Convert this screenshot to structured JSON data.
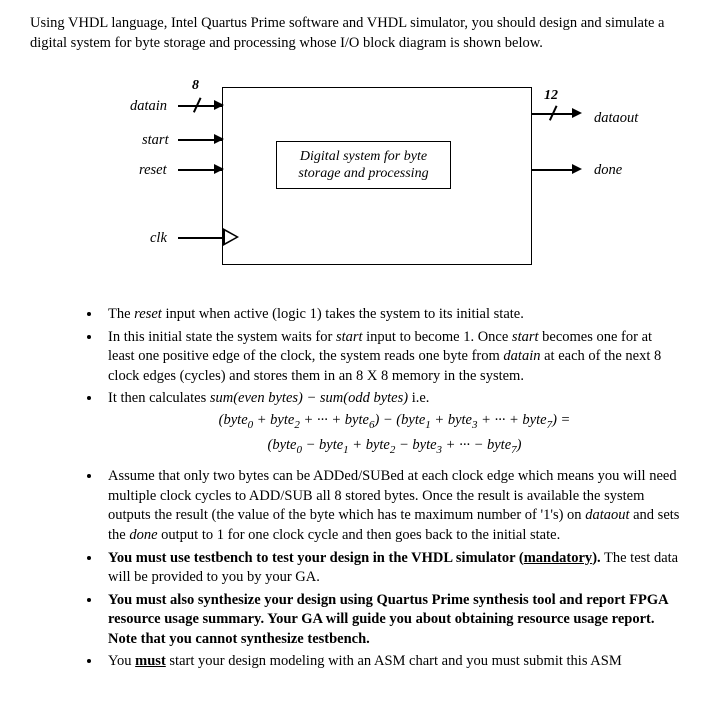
{
  "intro": "Using VHDL language, Intel Quartus Prime software and VHDL simulator, you should design and simulate a digital system for byte storage and processing whose I/O block diagram is shown below.",
  "diagram": {
    "datain": "datain",
    "start": "start",
    "reset": "reset",
    "clk": "clk",
    "dataout": "dataout",
    "done": "done",
    "bus_in": "8",
    "bus_out": "12",
    "box_line1": "Digital system for byte",
    "box_line2": "storage and processing"
  },
  "bullets": {
    "b1_pre": "The ",
    "b1_reset": "reset",
    "b1_post": " input when active (logic 1) takes the system to its initial state.",
    "b2_a": "In this initial state the system waits for ",
    "b2_start1": "start",
    "b2_b": " input to become 1. Once ",
    "b2_start2": "start",
    "b2_c": " becomes one for at least one positive edge of the clock, the system reads one byte from ",
    "b2_datain": "datain",
    "b2_d": " at each of the next 8 clock edges (cycles) and stores them in an 8 X 8 memory in the system.",
    "b3": "It then calculates ",
    "b3_expr": "sum(even bytes) − sum(odd bytes)",
    "b3_ie": " i.e.",
    "eq1_a": "(byte",
    "eq1_b": " + byte",
    "eq1_c": " + ··· + byte",
    "eq1_d": ") − (byte",
    "eq1_e": " + byte",
    "eq1_f": " + ··· + byte",
    "eq1_g": ") =",
    "eq2_a": "(byte",
    "eq2_b": " − byte",
    "eq2_c": " + byte",
    "eq2_d": " − byte",
    "eq2_e": " + ··· − byte",
    "eq2_f": ")",
    "b4_a": "Assume that only two bytes can be ADDed/SUBed at each clock edge which means you will need multiple clock cycles to ADD/SUB all 8 stored bytes. Once the result is available the system outputs the result (the value of the byte which has te maximum number of '1's) on ",
    "b4_dataout": "dataout",
    "b4_b": " and sets the ",
    "b4_done": "done",
    "b4_c": " output to 1 for one clock cycle and then goes back to the initial state.",
    "b5_a": "You must use testbench to test your design in the VHDL simulator (",
    "b5_mand": "mandatory",
    "b5_b": ").",
    "b5_c": " The test data will be provided to you by your GA.",
    "b6": "You must also synthesize your design using Quartus Prime synthesis tool and report FPGA resource usage summary. Your GA will guide you about obtaining resource usage report. Note that you cannot synthesize testbench.",
    "b7_a": "You ",
    "b7_must": "must",
    "b7_b": " start your design modeling with an ASM chart and you must submit this ASM"
  }
}
